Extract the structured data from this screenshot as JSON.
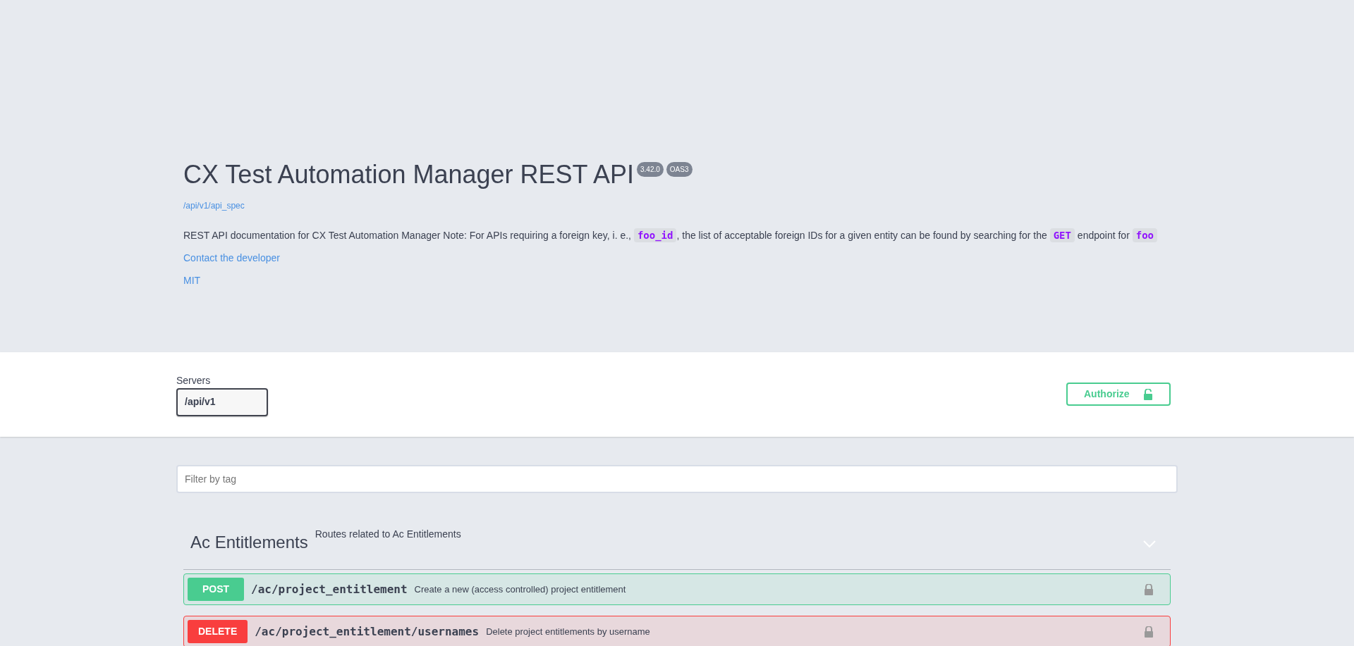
{
  "info": {
    "title": "CX Test Automation Manager REST API",
    "version": "3.42.0",
    "spec_badge": "OAS3",
    "spec_link": "/api/v1/api_spec",
    "description": [
      {
        "kind": "text",
        "text": "REST API documentation for CX Test Automation Manager Note: For APIs requiring a foreign key, i. e., "
      },
      {
        "kind": "code",
        "text": "foo_id"
      },
      {
        "kind": "text",
        "text": ", the list of acceptable foreign IDs for a given entity can be found by searching for the "
      },
      {
        "kind": "code",
        "text": "GET"
      },
      {
        "kind": "text",
        "text": " endpoint for "
      },
      {
        "kind": "code",
        "text": "foo"
      }
    ],
    "links": [
      "Contact the developer",
      "MIT"
    ]
  },
  "servers": {
    "label": "Servers",
    "value": "/api/v1"
  },
  "authorize": {
    "label": "Authorize"
  },
  "filter": {
    "placeholder": "Filter by tag"
  },
  "tags": [
    {
      "name": "Ac Entitlements",
      "description": "Routes related to Ac Entitlements",
      "expanded": true,
      "operations": [
        {
          "method": "POST",
          "path": "/ac/project_entitlement",
          "summary": "Create a new (access controlled) project entitlement",
          "locked": true
        },
        {
          "method": "DELETE",
          "path": "/ac/project_entitlement/usernames",
          "summary": "Delete project entitlements by username",
          "locked": true
        }
      ]
    }
  ]
}
